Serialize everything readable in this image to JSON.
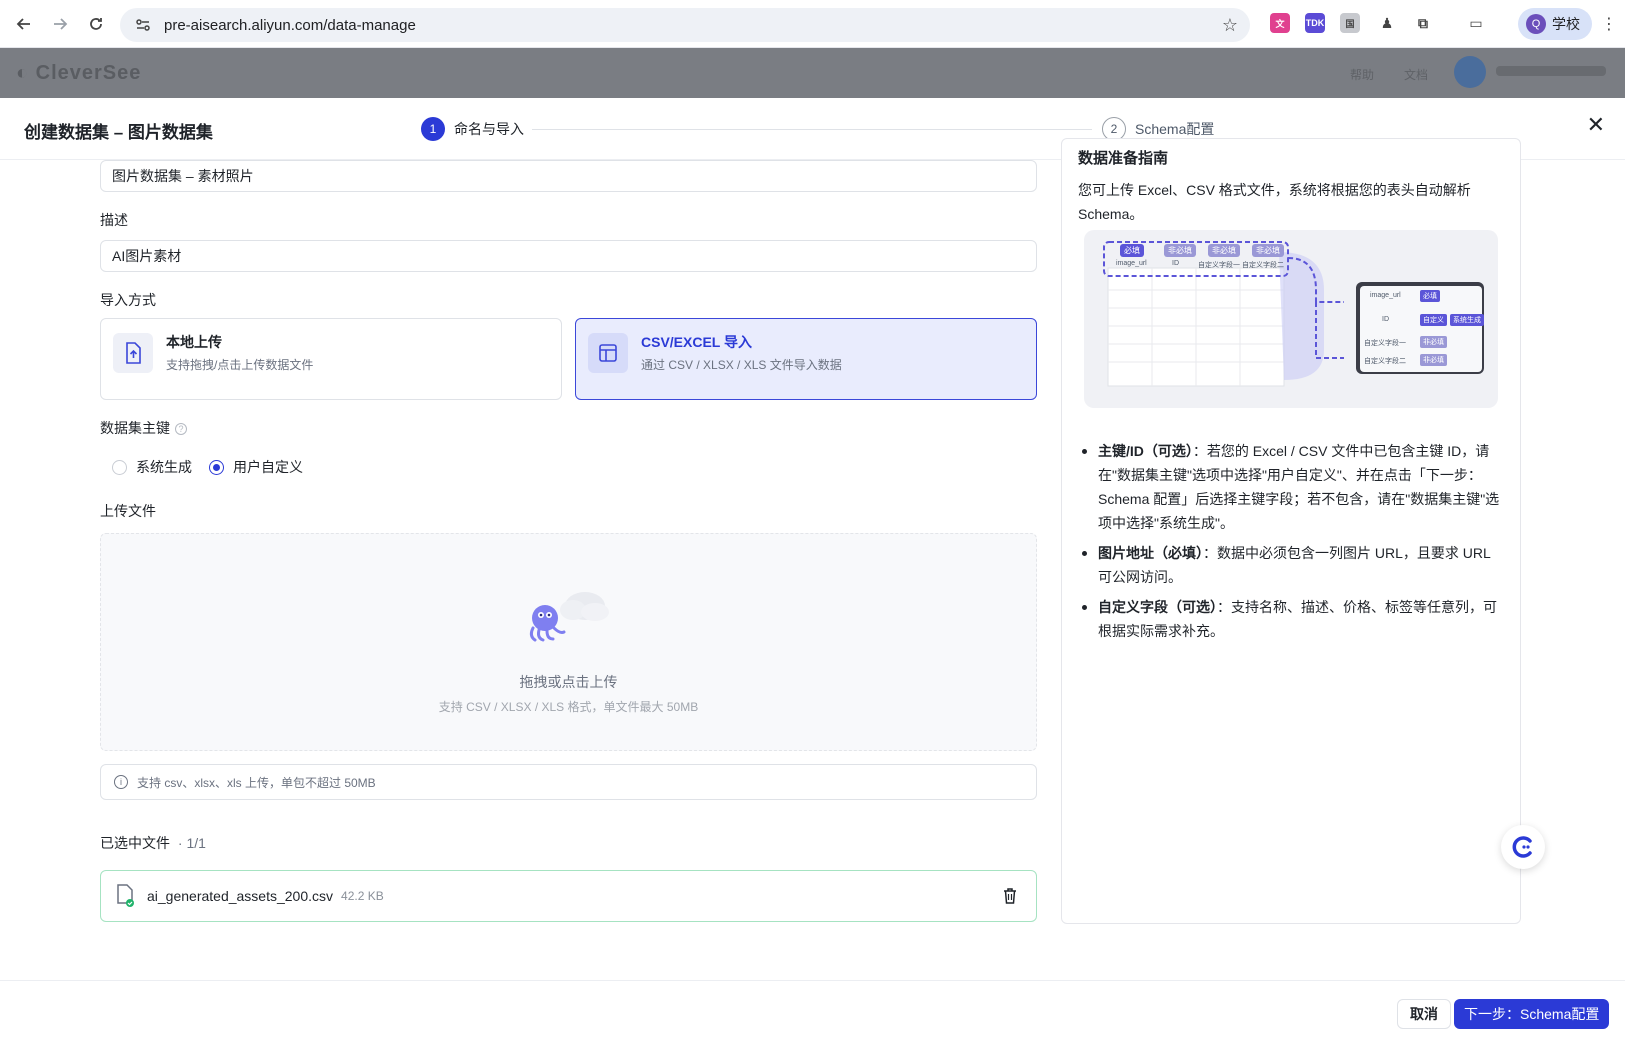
{
  "browser": {
    "url": "pre-aisearch.aliyun.com/data-manage",
    "profile_label": "学校",
    "profile_initial": "Q"
  },
  "modal": {
    "title": "创建数据集 – 图片数据集",
    "steps": [
      {
        "num": "1",
        "label": "命名与导入"
      },
      {
        "num": "2",
        "label": "Schema配置"
      }
    ]
  },
  "form": {
    "name_value": "图片数据集 – 素材照片",
    "desc_label": "描述",
    "desc_value": "AI图片素材",
    "import_label": "导入方式",
    "import_options": [
      {
        "title": "本地上传",
        "desc": "支持拖拽/点击上传数据文件"
      },
      {
        "title": "CSV/EXCEL 导入",
        "desc": "通过 CSV / XLSX / XLS 文件导入数据"
      }
    ],
    "pk_label": "数据集主键",
    "pk_options": [
      "系统生成",
      "用户自定义"
    ],
    "upload_label": "上传文件",
    "dropzone_main": "拖拽或点击上传",
    "dropzone_sub": "支持 CSV / XLSX / XLS 格式，单文件最大 50MB",
    "tip_text": "支持 csv、xlsx、xls 上传，单包不超过 50MB",
    "selected_label": "已选中文件",
    "selected_count": "· 1/1",
    "file_name": "ai_generated_assets_200.csv",
    "file_size": "42.2 KB"
  },
  "guide": {
    "title": "数据准备指南",
    "intro": "您可上传 Excel、CSV 格式文件，系统将根据您的表头自动解析 Schema。",
    "diagram_tags": [
      "必填",
      "非必填",
      "非必填",
      "非必填"
    ],
    "diagram_cols": [
      "image_url",
      "ID",
      "自定义字段一",
      "自定义字段二"
    ],
    "diagram_right_rows": [
      "image_url",
      "ID",
      "自定义字段一",
      "自定义字段二"
    ],
    "diagram_right_tags": [
      "必填",
      "自定义",
      "非必填",
      "非必填"
    ],
    "diagram_right_extra": "系统生成",
    "items": [
      {
        "bold": "主键/ID（可选）",
        "text": "：若您的 Excel / CSV 文件中已包含主键 ID，请在\"数据集主键\"选项中选择\"用户自定义\"、并在点击「下一步：Schema 配置」后选择主键字段；若不包含，请在\"数据集主键\"选项中选择\"系统生成\"。"
      },
      {
        "bold": "图片地址（必填）",
        "text": "：数据中必须包含一列图片 URL，且要求 URL 可公网访问。"
      },
      {
        "bold": "自定义字段（可选）",
        "text": "：支持名称、描述、价格、标签等任意列，可根据实际需求补充。"
      }
    ]
  },
  "footer": {
    "cancel": "取消",
    "next": "下一步：Schema配置"
  },
  "colors": {
    "accent": "#2b3ad6",
    "selected_card_bg": "#e9ecfd",
    "success_border": "#a6e3c2"
  }
}
